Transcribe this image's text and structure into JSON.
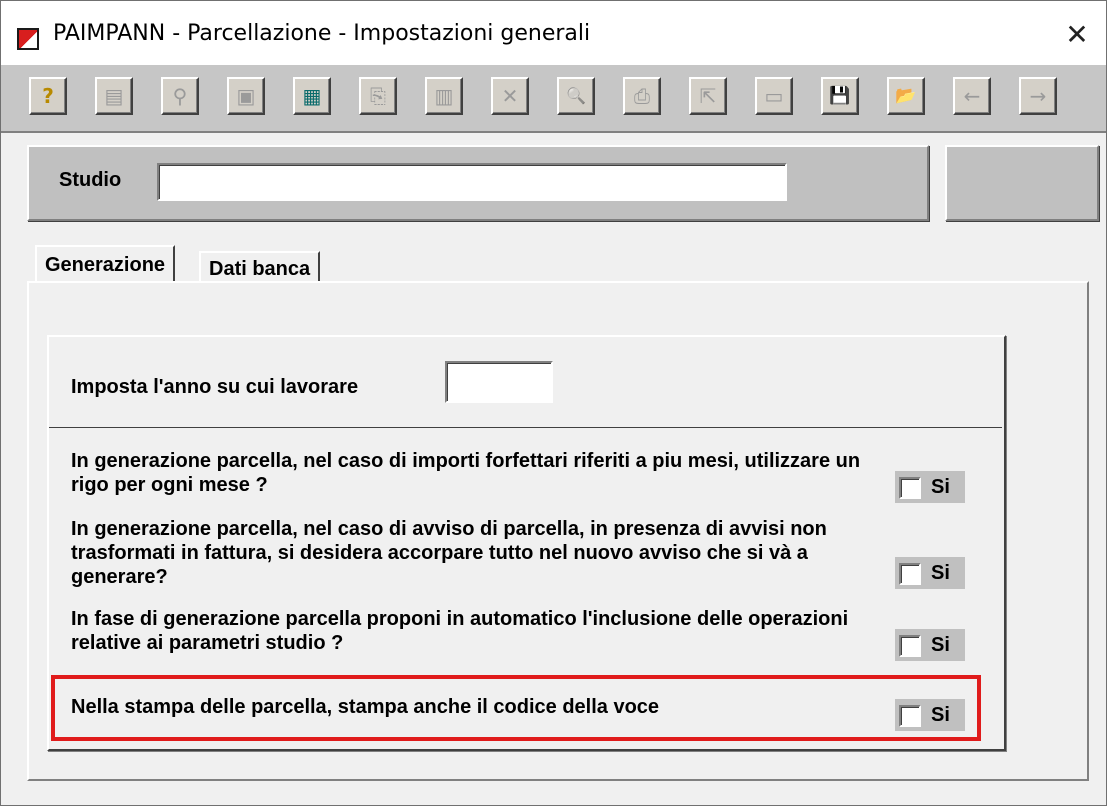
{
  "window": {
    "title": "PAIMPANN - Parcellazione - Impostazioni generali",
    "close_glyph": "✕"
  },
  "toolbar": {
    "buttons": [
      {
        "name": "help-icon",
        "glyph": "?"
      },
      {
        "name": "properties-icon",
        "glyph": "▤"
      },
      {
        "name": "binoculars-icon",
        "glyph": "⚲"
      },
      {
        "name": "windows-icon",
        "glyph": "▣"
      },
      {
        "name": "calculator-icon",
        "glyph": "▦"
      },
      {
        "name": "copy-icon",
        "glyph": "⎘"
      },
      {
        "name": "grid-icon",
        "glyph": "▥"
      },
      {
        "name": "delete-icon",
        "glyph": "✕"
      },
      {
        "name": "preview-icon",
        "glyph": "🔍"
      },
      {
        "name": "print-icon",
        "glyph": "⎙"
      },
      {
        "name": "export-icon",
        "glyph": "⇱"
      },
      {
        "name": "note-icon",
        "glyph": "▭"
      },
      {
        "name": "save-icon",
        "glyph": "💾"
      },
      {
        "name": "folder-up-icon",
        "glyph": "📂"
      },
      {
        "name": "arrow-left-icon",
        "glyph": "←"
      },
      {
        "name": "arrow-right-icon",
        "glyph": "→"
      }
    ]
  },
  "studio": {
    "label": "Studio",
    "value": ""
  },
  "tabs": [
    {
      "label": "Generazione",
      "active": true
    },
    {
      "label": "Dati banca",
      "active": false
    }
  ],
  "settings": {
    "year_label": "Imposta l'anno su cui lavorare",
    "year_value": "",
    "q1": "In generazione parcella, nel caso di importi forfettari riferiti a piu mesi, utilizzare un rigo per ogni mese ?",
    "q2": "In generazione parcella, nel caso di avviso di parcella, in presenza di avvisi non trasformati in fattura, si desidera accorpare tutto nel nuovo avviso che si và a generare?",
    "q3": "In fase di generazione parcella proponi in automatico l'inclusione delle operazioni relative ai parametri studio ?",
    "q4": "Nella stampa delle parcella, stampa anche il codice della voce",
    "checkbox_label": "Si"
  },
  "colors": {
    "highlight": "#e01b1b",
    "panel": "#c0c0c0",
    "background": "#f0f0f0"
  }
}
